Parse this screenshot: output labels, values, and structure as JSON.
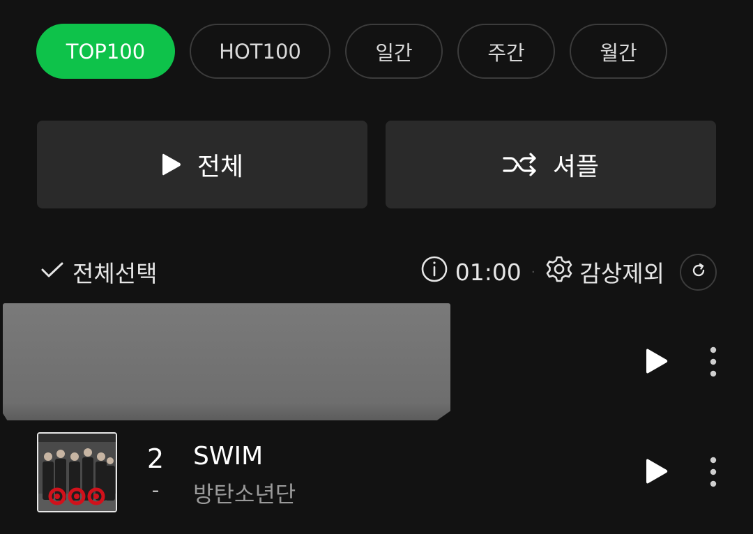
{
  "tabs": [
    {
      "label": "TOP100",
      "active": true
    },
    {
      "label": "HOT100",
      "active": false
    },
    {
      "label": "일간",
      "active": false
    },
    {
      "label": "주간",
      "active": false
    },
    {
      "label": "월간",
      "active": false
    }
  ],
  "actions": {
    "play_all_label": "전체",
    "shuffle_label": "셔플"
  },
  "toolbar": {
    "select_all_label": "전체선택",
    "update_time": "01:00",
    "separator": "·",
    "exclude_label": "감상제외"
  },
  "songs": [
    {
      "rank": "",
      "change": "",
      "title": "",
      "artist": ""
    },
    {
      "rank": "2",
      "change": "-",
      "title": "SWIM",
      "artist": "방탄소년단"
    }
  ],
  "colors": {
    "background": "#121212",
    "accent": "#0ec24a",
    "button_bg": "#2a2a2a",
    "chip_border": "#3c3c3c"
  },
  "icons": {
    "play_all": "play-icon",
    "shuffle": "shuffle-icon",
    "select_all": "check-icon",
    "info": "info-icon",
    "settings": "gear-icon",
    "refresh": "refresh-icon",
    "row_play": "play-icon",
    "row_more": "more-vertical-icon"
  }
}
